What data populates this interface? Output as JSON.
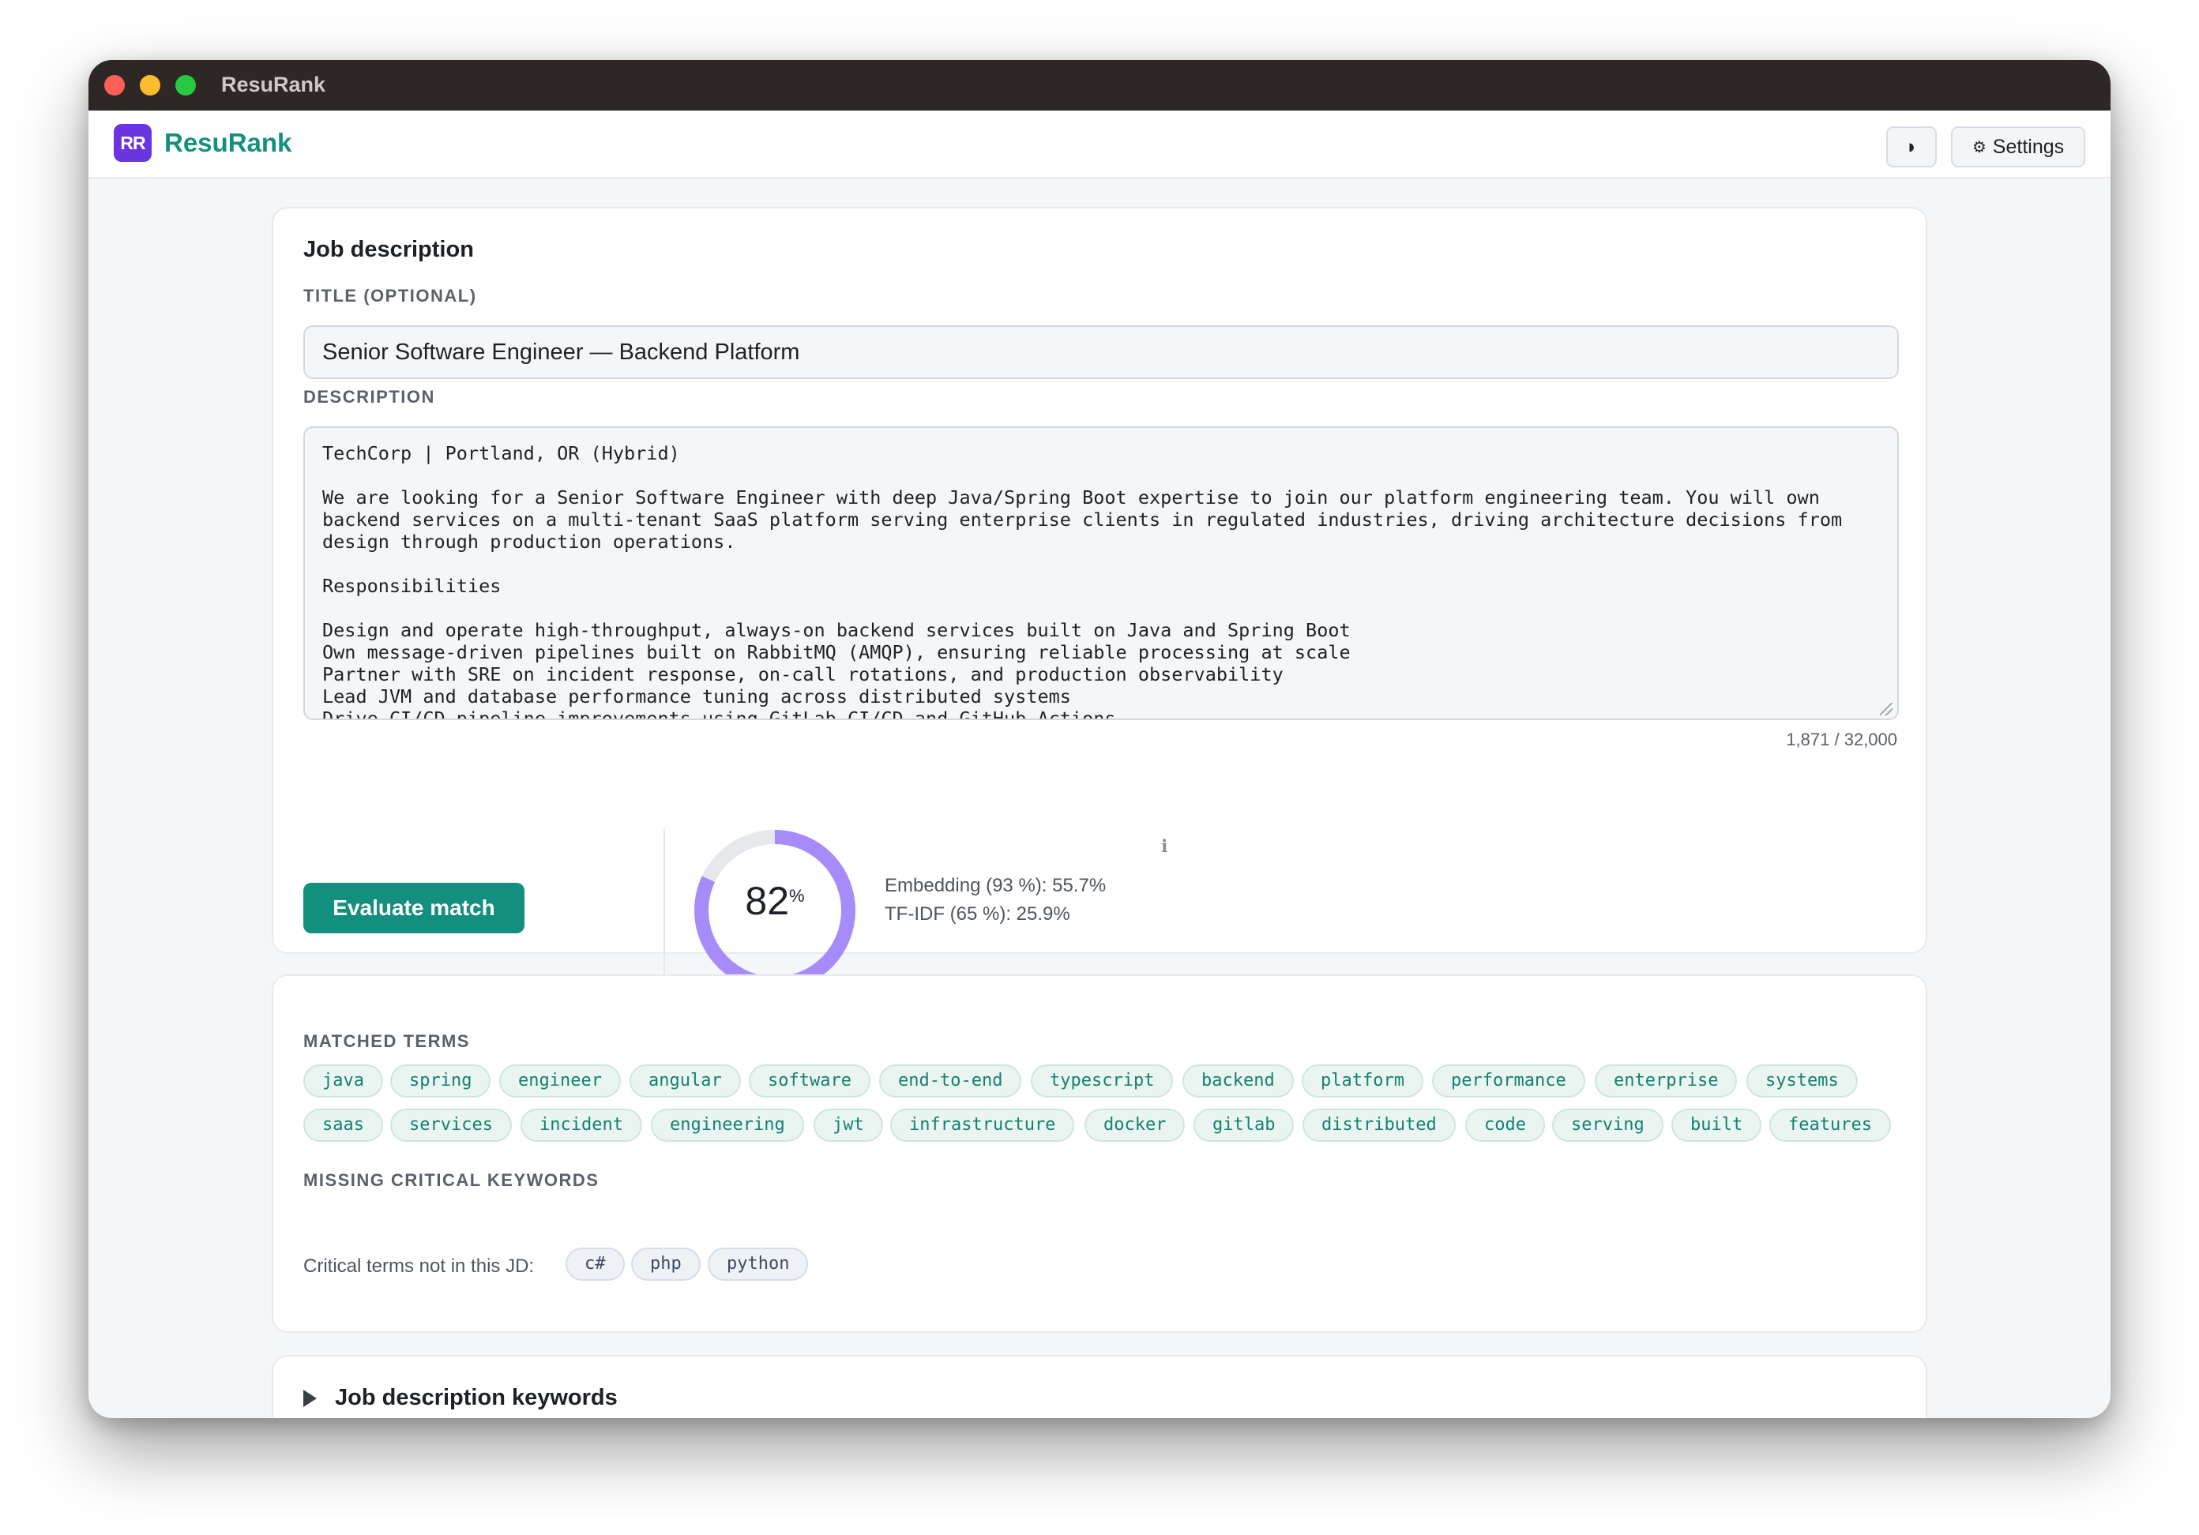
{
  "window": {
    "title": "ResuRank"
  },
  "appbar": {
    "logo_text": "RR",
    "brand": "ResuRank",
    "theme_icon": "half-moon-icon",
    "theme_glyph": "◗",
    "settings_icon": "⚙",
    "settings_label": "Settings"
  },
  "job": {
    "heading": "Job description",
    "title_label": "TITLE (OPTIONAL)",
    "title_value": "Senior Software Engineer — Backend Platform",
    "description_label": "DESCRIPTION",
    "description_value": "TechCorp | Portland, OR (Hybrid)\n\nWe are looking for a Senior Software Engineer with deep Java/Spring Boot expertise to join our platform engineering team. You will own backend services on a multi-tenant SaaS platform serving enterprise clients in regulated industries, driving architecture decisions from design through production operations.\n\nResponsibilities\n\nDesign and operate high-throughput, always-on backend services built on Java and Spring Boot\nOwn message-driven pipelines built on RabbitMQ (AMQP), ensuring reliable processing at scale\nPartner with SRE on incident response, on-call rotations, and production observability\nLead JVM and database performance tuning across distributed systems\nDrive CI/CD pipeline improvements using GitLab CI/CD and GitHub Actions",
    "char_counter": "1,871 / 32,000"
  },
  "evaluation": {
    "button_label": "Evaluate match",
    "score": 82,
    "score_value": "82",
    "score_unit": "%",
    "info_glyph": "ℹ",
    "embedding_line": "Embedding (93 %): 55.7%",
    "tfidf_line": "TF-IDF (65 %): 25.9%",
    "colors": {
      "ring": "#a78bfa",
      "track": "#e6e8eb",
      "accent": "#138f80"
    }
  },
  "terms": {
    "matched_label": "MATCHED TERMS",
    "matched": [
      "java",
      "spring",
      "engineer",
      "angular",
      "software",
      "end-to-end",
      "typescript",
      "backend",
      "platform",
      "performance",
      "enterprise",
      "systems",
      "saas",
      "services",
      "incident",
      "engineering",
      "jwt",
      "infrastructure",
      "docker",
      "gitlab",
      "distributed",
      "code",
      "serving",
      "built",
      "features"
    ],
    "missing_label": "MISSING CRITICAL KEYWORDS",
    "missing_prefix": "Critical terms not in this JD:",
    "missing": [
      "c#",
      "php",
      "python"
    ]
  },
  "keywords_section": {
    "title": "Job description keywords"
  }
}
